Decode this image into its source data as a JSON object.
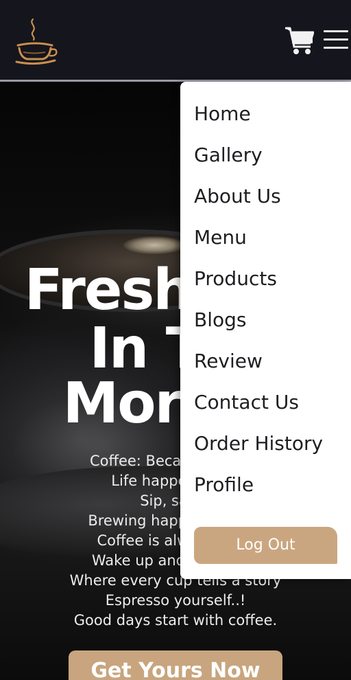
{
  "header": {
    "logo_icon": "coffee-cup-logo-icon",
    "cart_icon": "shopping-cart-icon",
    "menu_icon": "hamburger-menu-icon",
    "brand_color": "#c8a57e"
  },
  "hero": {
    "title_lines": [
      "Fresh C",
      "In T",
      "Morn"
    ],
    "taglines": [
      "Coffee: Because a",
      "Life happens, c",
      "Sip, savor",
      "Brewing happiness,",
      "Coffee is alway",
      "Wake up and sm",
      "Where every cup tells a story",
      "Espresso yourself..!",
      "Good days start with coffee."
    ],
    "cta_label": "Get Yours Now"
  },
  "nav_menu": {
    "items": [
      {
        "label": "Home"
      },
      {
        "label": "Gallery"
      },
      {
        "label": "About Us"
      },
      {
        "label": "Menu"
      },
      {
        "label": "Products"
      },
      {
        "label": "Blogs"
      },
      {
        "label": "Review"
      },
      {
        "label": "Contact Us"
      },
      {
        "label": "Order History"
      },
      {
        "label": "Profile"
      }
    ],
    "logout_label": "Log Out"
  }
}
